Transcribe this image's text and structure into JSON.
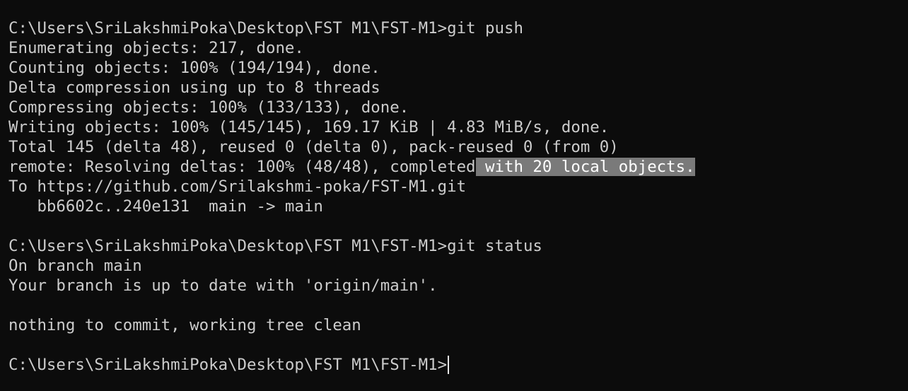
{
  "terminal": {
    "push": {
      "prompt": "C:\\Users\\SriLakshmiPoka\\Desktop\\FST M1\\FST-M1>",
      "command": "git push",
      "output": [
        "Enumerating objects: 217, done.",
        "Counting objects: 100% (194/194), done.",
        "Delta compression using up to 8 threads",
        "Compressing objects: 100% (133/133), done.",
        "Writing objects: 100% (145/145), 169.17 KiB | 4.83 MiB/s, done.",
        "Total 145 (delta 48), reused 0 (delta 0), pack-reused 0 (from 0)"
      ],
      "remote_line": {
        "before_selection": "remote: Resolving deltas: 100% (48/48), completed",
        "selected": " with 20 local objects."
      },
      "to_line": "To https://github.com/Srilakshmi-poka/FST-M1.git",
      "ref_line": "   bb6602c..240e131  main -> main"
    },
    "status": {
      "prompt": "C:\\Users\\SriLakshmiPoka\\Desktop\\FST M1\\FST-M1>",
      "command": "git status",
      "output": [
        "On branch main",
        "Your branch is up to date with 'origin/main'.",
        "",
        "nothing to commit, working tree clean"
      ]
    },
    "current": {
      "prompt": "C:\\Users\\SriLakshmiPoka\\Desktop\\FST M1\\FST-M1>",
      "input": ""
    }
  },
  "colors": {
    "background": "#0c0c0c",
    "foreground": "#cccccc",
    "selection": "#7a7a7a"
  }
}
